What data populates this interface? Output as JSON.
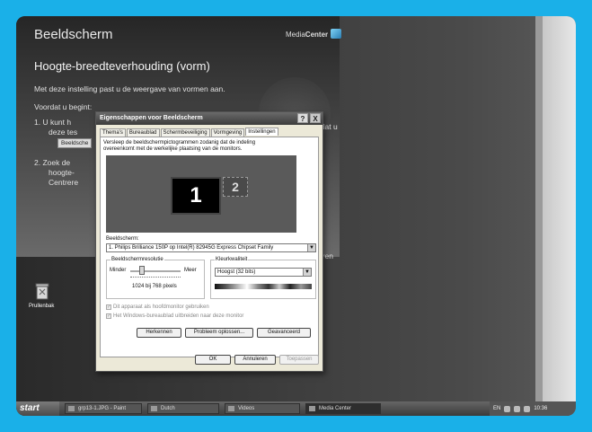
{
  "media_center": {
    "title": "Beeldscherm",
    "brand_prefix": "Media",
    "brand_bold": "Center",
    "subtitle": "Hoogte-breedteverhouding (vorm)",
    "intro": "Met deze instelling past u de weergave van vormen aan.",
    "before_heading": "Voordat u begint:",
    "step1_line1": "1.  U kunt h",
    "step1_line2": "deze tes",
    "step1_button": "Beeldsche",
    "step2_line1": "2.  Zoek de",
    "step2_line2": "hoogte-",
    "step2_line3": "Centrere",
    "side_text1": "rdat u",
    "side_text2": "eren"
  },
  "desktop": {
    "recycle_bin_label": "Prullenbak"
  },
  "dialog": {
    "title": "Eigenschappen voor Beeldscherm",
    "help_label": "?",
    "close_label": "X",
    "tabs": [
      "Thema's",
      "Bureaublad",
      "Schermbeveiliging",
      "Vormgeving",
      "Instellingen"
    ],
    "active_tab_index": 4,
    "description": "Versleep de beeldschermpictogrammen zodanig dat de indeling overeenkomt met de werkelijke plaatsing van de monitors.",
    "monitor1_label": "1",
    "monitor2_label": "2",
    "display_label": "Beeldscherm:",
    "display_value": "1. Philips Brilliance 150P op Intel(R) 82945G Express Chipset Family",
    "resolution_group": "Beeldschermresolutie",
    "less_label": "Minder",
    "more_label": "Meer",
    "resolution_value": "1024 bij 768 pixels",
    "color_group": "Kleurkwaliteit",
    "color_value": "Hoogst (32 bits)",
    "check_primary": "Dit apparaat als hoofdmonitor gebruiken",
    "check_extend": "Het Windows-bureaublad uitbreiden naar deze monitor",
    "btn_identify": "Herkennen",
    "btn_troubleshoot": "Probleem oplossen...",
    "btn_advanced": "Geavanceerd",
    "btn_ok": "OK",
    "btn_cancel": "Annuleren",
    "btn_apply": "Toepassen"
  },
  "taskbar": {
    "start_label": "start",
    "tasks": [
      "grp13-1.JPG - Paint",
      "Dutch",
      "Videos",
      "Media Center"
    ],
    "active_task_index": 3,
    "language": "EN",
    "time": "10:36"
  }
}
